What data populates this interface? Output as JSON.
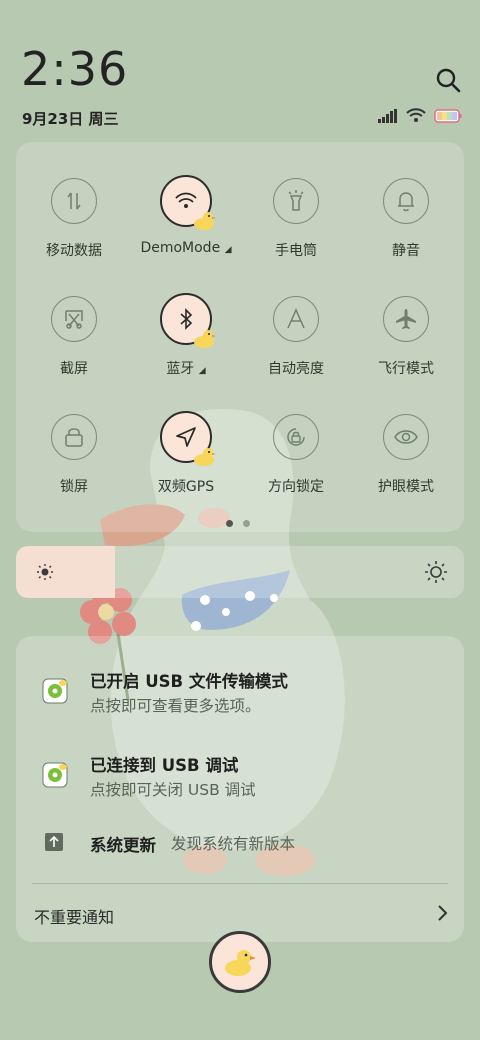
{
  "status": {
    "time": "2:36",
    "date": "9月23日 周三",
    "icons": [
      "search-icon",
      "signal-icon",
      "wifi-icon",
      "battery-icon"
    ]
  },
  "quick_settings": {
    "tiles": [
      {
        "label": "移动数据",
        "icon": "mobile-data-icon",
        "on": false
      },
      {
        "label": "DemoMode",
        "icon": "wifi-icon",
        "on": true,
        "has_menu": true
      },
      {
        "label": "手电筒",
        "icon": "flashlight-icon",
        "on": false
      },
      {
        "label": "静音",
        "icon": "bell-icon",
        "on": false
      },
      {
        "label": "截屏",
        "icon": "screenshot-icon",
        "on": false
      },
      {
        "label": "蓝牙",
        "icon": "bluetooth-icon",
        "on": true,
        "has_menu": true
      },
      {
        "label": "自动亮度",
        "icon": "auto-brightness-icon",
        "on": false
      },
      {
        "label": "飞行模式",
        "icon": "airplane-icon",
        "on": false
      },
      {
        "label": "锁屏",
        "icon": "lock-icon",
        "on": false
      },
      {
        "label": "双频GPS",
        "icon": "gps-icon",
        "on": true
      },
      {
        "label": "方向锁定",
        "icon": "rotation-lock-icon",
        "on": false
      },
      {
        "label": "护眼模式",
        "icon": "eye-icon",
        "on": false
      }
    ],
    "page_count": 2,
    "current_page": 1
  },
  "brightness": {
    "level": 0.22
  },
  "notifications": [
    {
      "title": "已开启 USB 文件传输模式",
      "body": "点按即可查看更多选项。",
      "icon": "usb-settings-icon"
    },
    {
      "title": "已连接到 USB 调试",
      "body": "点按即可关闭 USB 调试",
      "icon": "usb-settings-icon"
    },
    {
      "title": "系统更新",
      "body": "发现系统有新版本",
      "icon": "system-update-icon"
    }
  ],
  "quiet_section": {
    "label": "不重要通知"
  },
  "colors": {
    "background": "#b8c9b1",
    "tile_on": "#fbe5d8",
    "accent_green": "#7bbf3a"
  }
}
